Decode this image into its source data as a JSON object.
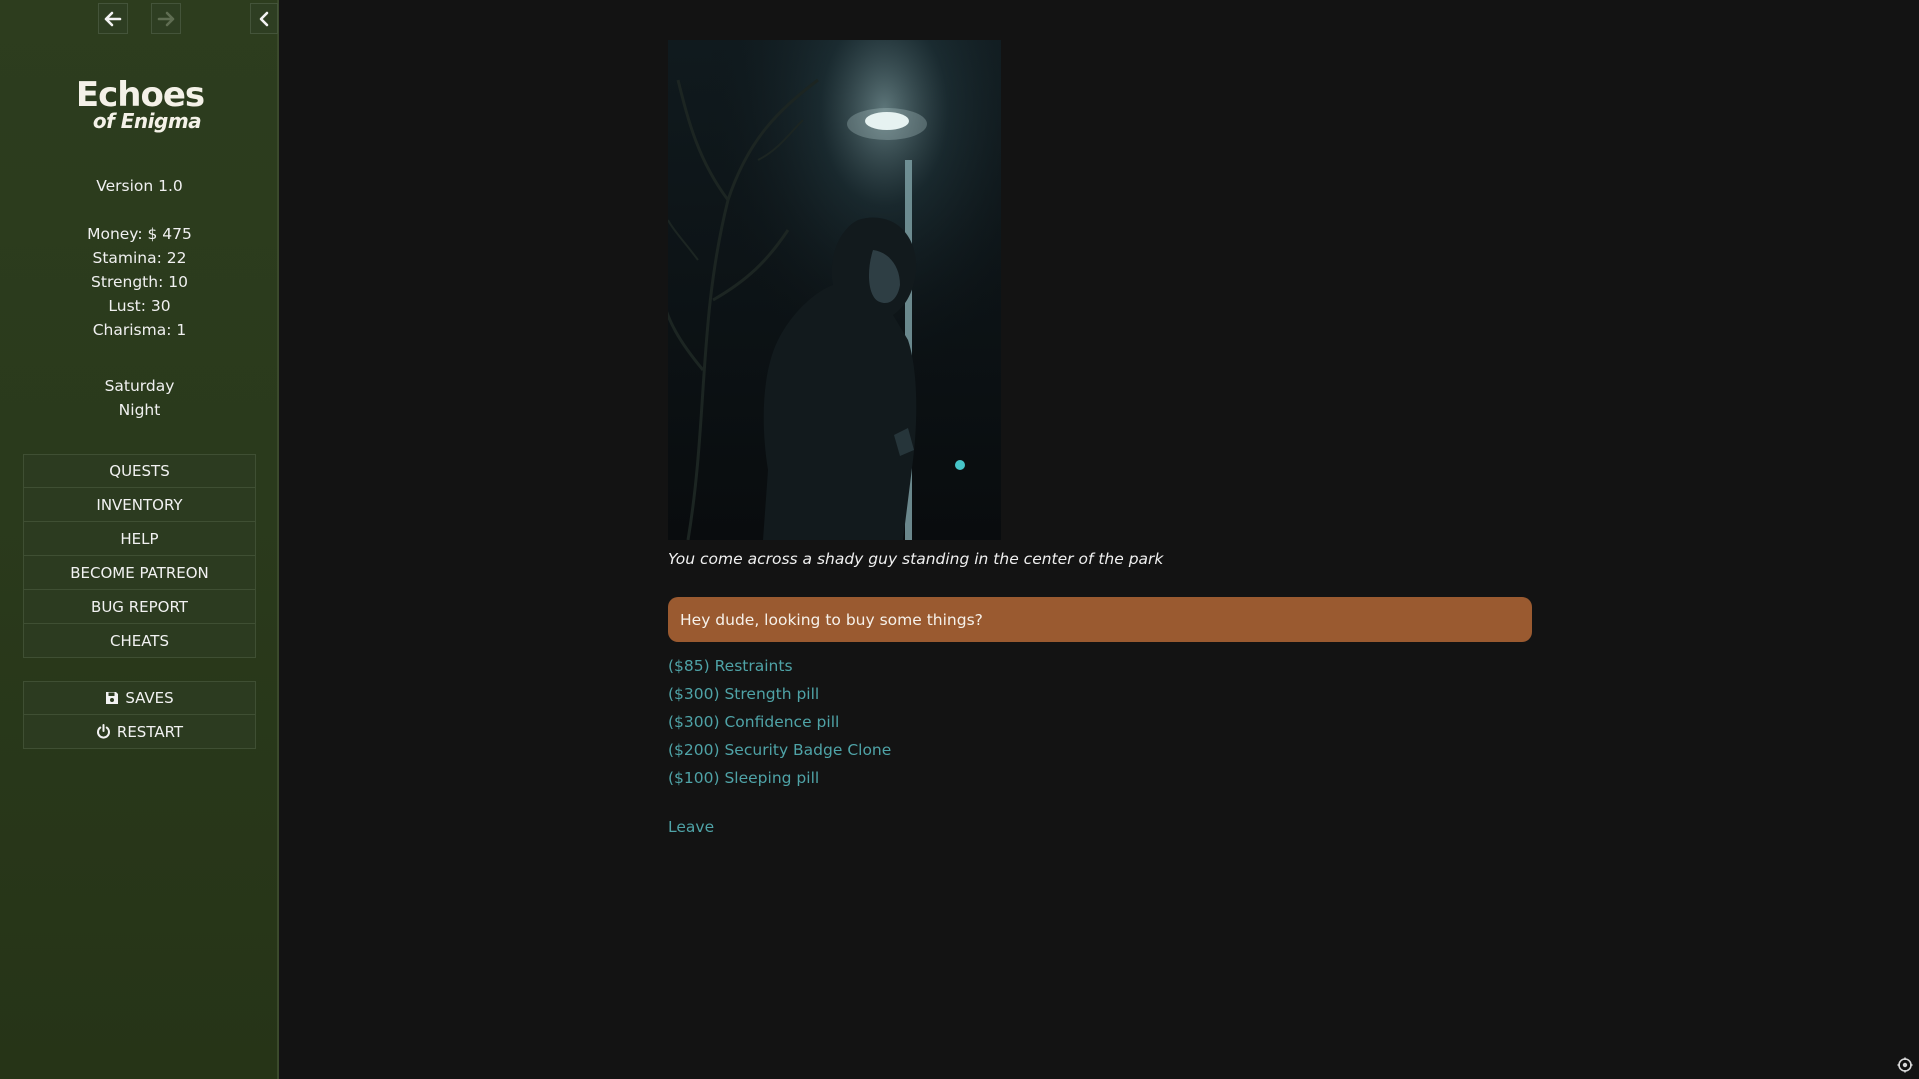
{
  "game": {
    "logo_line1": "Echoes",
    "logo_line2": "of Enigma",
    "version": "Version 1.0"
  },
  "stats": {
    "money": "Money: $ 475",
    "stamina": "Stamina: 22",
    "strength": "Strength: 10",
    "lust": "Lust: 30",
    "charisma": "Charisma: 1"
  },
  "time": {
    "day": "Saturday",
    "period": "Night"
  },
  "menu": {
    "quests": "QUESTS",
    "inventory": "INVENTORY",
    "help": "HELP",
    "patreon": "BECOME PATREON",
    "bug_report": "BUG REPORT",
    "cheats": "CHEATS",
    "saves": "SAVES",
    "restart": "RESTART"
  },
  "icons": {
    "back": "arrow-left-icon",
    "forward": "arrow-right-icon",
    "collapse": "chevron-left-icon",
    "saves": "floppy-disk-icon",
    "restart": "power-icon",
    "settings": "settings-icon"
  },
  "passage": {
    "narration": "You come across a shady guy standing in the center of the park",
    "speech": "Hey dude, looking to buy some things?",
    "speech_color": "#9a5a30",
    "link_color": "#4fa3a7",
    "options": [
      "($85) Restraints",
      "($300) Strength pill",
      "($300) Confidence pill",
      "($200) Security Badge Clone",
      "($100) Sleeping pill"
    ],
    "leave": "Leave"
  }
}
